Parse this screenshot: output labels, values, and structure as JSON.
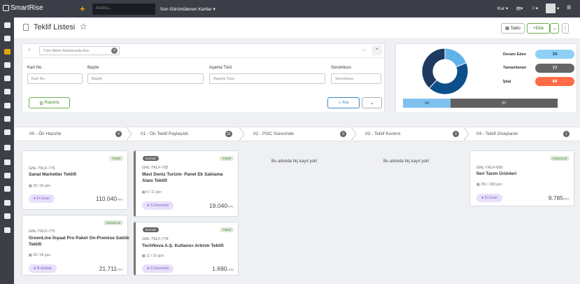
{
  "topbar": {
    "brand": "SmartRise",
    "search_placeholder": "Arama...",
    "recent": "Son Görüntülenen Kartlar ▾",
    "currency": "Kur ▾",
    "menu_icons": [
      "calendar-icon",
      "flag-icon"
    ]
  },
  "header": {
    "title": "Teklif Listesi",
    "view_button": "Tablo",
    "add_button": "Ekle"
  },
  "filters": {
    "search_placeholder": "Tüm Metin Alanlarında Ara",
    "labels": {
      "card_no": "Kart No",
      "title": "Başlık",
      "stage_type": "Aşama Türü",
      "responsible": "Sorumlusu"
    },
    "placeholders": {
      "card_no": "Kart No",
      "title": "Başlık",
      "stage_type": "Aşama Türü",
      "responsible": "Sorumlusu"
    },
    "report_button": "Raporla",
    "search_button": "Ara"
  },
  "stats": {
    "rows": [
      {
        "label": "Devam Eden",
        "value": "34",
        "color": "#8fd0f7"
      },
      {
        "label": "Tamamlanan",
        "value": "77",
        "color": "#666666"
      },
      {
        "label": "İptal",
        "value": "68",
        "color": "#ff6c45"
      }
    ],
    "bars": [
      {
        "value": "34"
      },
      {
        "value": "57"
      }
    ]
  },
  "chart_data": {
    "type": "pie",
    "values": [
      34,
      77,
      68
    ],
    "labels": [
      "Devam Eden",
      "Tamamlanan",
      "İptal"
    ],
    "colors": [
      "#5fb3e8",
      "#0d4f8a",
      "#1e3a5f"
    ]
  },
  "stages": [
    {
      "name": "00 - Ön Hazırlık",
      "count": "4"
    },
    {
      "name": "01 - Ön Teklif Paylaşıldı",
      "count": "32"
    },
    {
      "name": "02 - POC Sürecinde",
      "count": "0"
    },
    {
      "name": "03 - Teklif Kontrol",
      "count": "0"
    },
    {
      "name": "04 - Teklif Onaylandı",
      "count": "1"
    }
  ],
  "empty_text": "Bu adımda hiç kayıt yok!",
  "cards": [
    {
      "badge": "Panel",
      "priority": "",
      "code": "GNL-TKLF-776",
      "title": "Sanal Marketler Teklifi",
      "qty": "30 / 30",
      "unit": "gün",
      "owner": "D.Uzun",
      "price": "110.040",
      "currency": "TRY"
    },
    {
      "badge": "Kazanıcal",
      "priority": "",
      "code": "GNL-TKLF-775",
      "title": "GreenLine İnşaat Pro Paket On-Premise Satılık Teklifi",
      "qty": "28 / 28",
      "unit": "gün",
      "owner": "B.Adalar",
      "price": "21.711",
      "currency": "TRY"
    },
    {
      "badge": "Panel",
      "priority": "Normal",
      "code": "GNL-TKLF-782",
      "title": "Mavi Deniz Turizm- Panel Ek Saklama Alanı Teklifi",
      "qty": "5 / 11",
      "unit": "gün",
      "owner": "S.Sevenöz",
      "price": "19.040",
      "currency": "TRY"
    },
    {
      "badge": "Panel",
      "priority": "Normal",
      "code": "GNL-TKLF-778",
      "title": "TechNova A.Ş. Kullanıcı Artırım Teklifi",
      "qty": "11 / 10",
      "unit": "gün",
      "owner": "S.Sevenöz",
      "price": "1.690",
      "currency": "USD"
    },
    {
      "badge": "Kazanıcal",
      "priority": "",
      "code": "GNL-TKLF-650",
      "title": "İleri Tarım Ürünleri",
      "qty": "281 / 288",
      "unit": "gün",
      "owner": "D.Uzun",
      "price": "9.785",
      "currency": "TRY"
    }
  ]
}
